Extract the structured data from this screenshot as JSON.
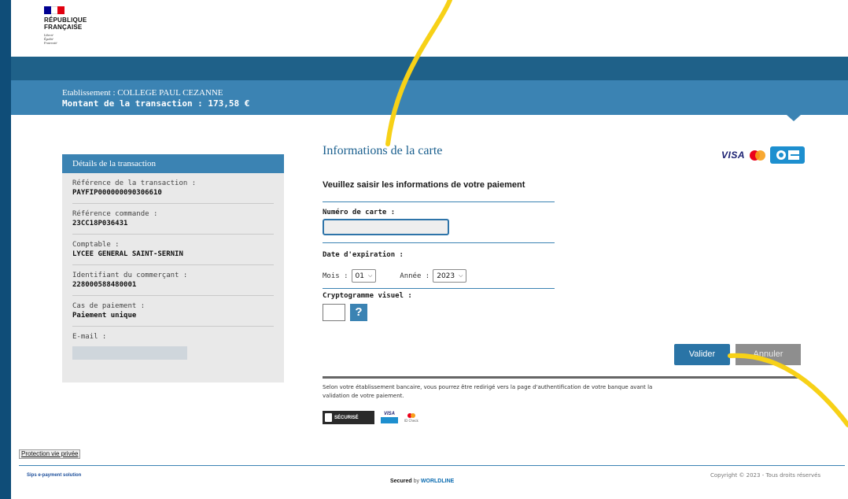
{
  "header": {
    "republic_name_line1": "RÉPUBLIQUE",
    "republic_name_line2": "FRANÇAISE",
    "motto": [
      "Liberté",
      "Égalité",
      "Fraternité"
    ],
    "flag_colors": [
      "#000091",
      "#ffffff",
      "#e1000f"
    ]
  },
  "transaction_banner": {
    "establishment": "Etablissement : COLLEGE PAUL CEZANNE",
    "amount": "Montant de la transaction :  173,58 €"
  },
  "details": {
    "title": "Détails de la transaction",
    "items": [
      {
        "label": "Référence de la transaction :",
        "value": "PAYFIP000000090306610"
      },
      {
        "label": "Référence commande :",
        "value": "23CC18P036431"
      },
      {
        "label": "Comptable :",
        "value": "LYCEE GENERAL SAINT-SERNIN"
      },
      {
        "label": "Identifiant du commerçant :",
        "value": "228000588480001"
      },
      {
        "label": "Cas de paiement :",
        "value": "Paiement unique"
      },
      {
        "label": "E-mail :",
        "value": ""
      }
    ]
  },
  "card_form": {
    "title": "Informations de la carte",
    "subtitle": "Veuillez saisir les informations de votre paiement",
    "card_number_label": "Numéro de carte :",
    "card_number_value": "",
    "expiry_label": "Date d'expiration :",
    "month_label": "Mois :",
    "month_value": "01",
    "year_label": "Année :",
    "year_value": "2023",
    "cvv_label": "Cryptogramme visuel :",
    "help_label": "?",
    "submit_label": "Valider",
    "cancel_label": "Annuler",
    "brands": {
      "visa": "VISA"
    },
    "notice": "Selon votre établissement bancaire, vous pourrez être redirigé vers la page d'authentification de votre banque avant la validation de votre paiement.",
    "secure_badge": "SÉCURISÉ",
    "mini_visa": "VISA",
    "mini_mc": "ID Check"
  },
  "footer": {
    "privacy_link": "Protection vie privée",
    "sips": "Sips e-payment solution",
    "secured_prefix": "Secured",
    "secured_by": " by ",
    "secured_brand": "WORLDLINE",
    "copyright": "Copyright © 2023 - Tous droits réservés"
  },
  "annotation_color": "#f7d117"
}
